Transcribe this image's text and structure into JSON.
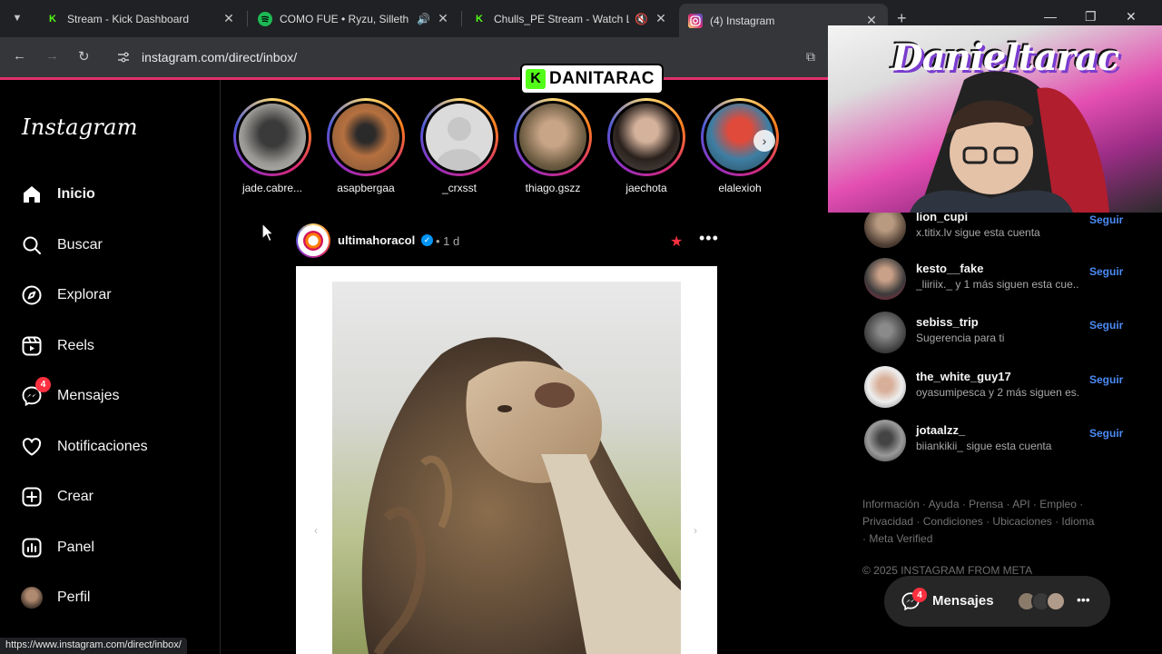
{
  "browser": {
    "tabs": [
      {
        "title": "Stream - Kick Dashboard",
        "favicon": "kick-icon",
        "color": "#53fc18"
      },
      {
        "title": "COMO FUE • Ryzu, Silleth",
        "favicon": "spotify-icon",
        "color": "#1db954"
      },
      {
        "title": "Chulls_PE Stream - Watch L",
        "favicon": "kick-icon",
        "color": "#53fc18"
      },
      {
        "title": "(4) Instagram",
        "favicon": "instagram-icon",
        "color": "#e1306c"
      }
    ],
    "url": "instagram.com/direct/inbox/",
    "status_url": "https://www.instagram.com/direct/inbox/"
  },
  "sidebar": {
    "logo": "Instagram",
    "items": [
      {
        "label": "Inicio",
        "icon": "home-icon"
      },
      {
        "label": "Buscar",
        "icon": "search-icon"
      },
      {
        "label": "Explorar",
        "icon": "compass-icon"
      },
      {
        "label": "Reels",
        "icon": "reels-icon"
      },
      {
        "label": "Mensajes",
        "icon": "messenger-icon",
        "badge": "4"
      },
      {
        "label": "Notificaciones",
        "icon": "heart-icon"
      },
      {
        "label": "Crear",
        "icon": "plus-square-icon"
      },
      {
        "label": "Panel",
        "icon": "chart-icon"
      },
      {
        "label": "Perfil",
        "icon": "profile-avatar"
      }
    ]
  },
  "stories": [
    {
      "name": "jade.cabre...",
      "color": "#7d7b78"
    },
    {
      "name": "asapbergaa",
      "color": "#a6633f"
    },
    {
      "name": "_crxsst",
      "color": "#cfd4da"
    },
    {
      "name": "thiago.gszz",
      "color": "#8d7a5c"
    },
    {
      "name": "jaechota",
      "color": "#5a4a45"
    },
    {
      "name": "elalexioh",
      "color": "#3a6e8f"
    }
  ],
  "post": {
    "username": "ultimahoracol",
    "time": "• 1 d"
  },
  "suggestions": [
    {
      "username": "lion_cupi",
      "subtitle": "x.titix.lv sigue esta cuenta",
      "action": "Seguir",
      "color": "#6b5a4a"
    },
    {
      "username": "kesto__fake",
      "subtitle": "_liiriix._ y 1 más siguen esta cue...",
      "action": "Seguir",
      "color": "#4a4a4a"
    },
    {
      "username": "sebiss_trip",
      "subtitle": "Sugerencia para ti",
      "action": "Seguir",
      "color": "#5c5c5c"
    },
    {
      "username": "the_white_guy17",
      "subtitle": "oyasumipesca y 2 más siguen es...",
      "action": "Seguir",
      "color": "#8a7a6a"
    },
    {
      "username": "jotaalzz_",
      "subtitle": "biiankikii_ sigue esta cuenta",
      "action": "Seguir",
      "color": "#555555"
    }
  ],
  "footer": {
    "links": "Información · Ayuda · Prensa · API · Empleo · Privacidad · Condiciones · Ubicaciones · Idioma · Meta Verified",
    "copyright": "© 2025 INSTAGRAM FROM META"
  },
  "messages_pill": {
    "label": "Mensajes",
    "badge": "4"
  },
  "stream_overlay": {
    "streamer_tag": "DANITARAC",
    "kick_logo": "K",
    "cam_art_text": "Danieltarac"
  }
}
